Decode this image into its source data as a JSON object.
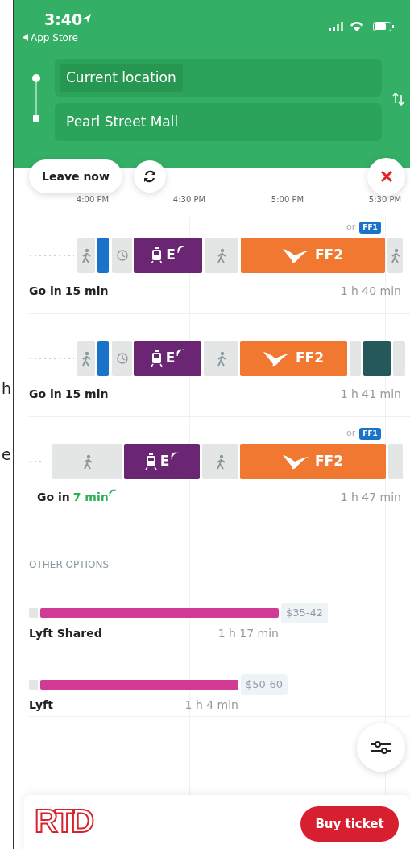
{
  "margin_text": [
    "h",
    "e"
  ],
  "status_bar": {
    "time": "3:40",
    "back_label": "App Store"
  },
  "route": {
    "origin": "Current location",
    "destination": "Pearl Street Mall"
  },
  "controls": {
    "leave_label": "Leave now"
  },
  "timeline": {
    "ticks": [
      "4:00 PM",
      "4:30 PM",
      "5:00 PM",
      "5:30 PM"
    ]
  },
  "trips": [
    {
      "alternative": {
        "prefix": "or",
        "route": "FF1"
      },
      "segments": [
        {
          "kind": "dots"
        },
        {
          "kind": "walk"
        },
        {
          "kind": "alert"
        },
        {
          "kind": "wait"
        },
        {
          "kind": "rail",
          "label": "E",
          "realtime": true
        },
        {
          "kind": "walk"
        },
        {
          "kind": "bus",
          "label": "FF2"
        },
        {
          "kind": "walk"
        }
      ],
      "depart_prefix": "Go in",
      "depart_time": "15 min",
      "realtime": false,
      "duration": "1 h 40 min"
    },
    {
      "segments": [
        {
          "kind": "dots"
        },
        {
          "kind": "walk"
        },
        {
          "kind": "alert"
        },
        {
          "kind": "wait"
        },
        {
          "kind": "rail",
          "label": "E",
          "realtime": true
        },
        {
          "kind": "walk"
        },
        {
          "kind": "bus",
          "label": "FF2"
        },
        {
          "kind": "gap"
        },
        {
          "kind": "block"
        },
        {
          "kind": "gap"
        }
      ],
      "depart_prefix": "Go in",
      "depart_time": "15 min",
      "realtime": false,
      "duration": "1 h 41 min"
    },
    {
      "alternative": {
        "prefix": "or",
        "route": "FF1"
      },
      "segments": [
        {
          "kind": "dots"
        },
        {
          "kind": "walk"
        },
        {
          "kind": "rail",
          "label": "E",
          "realtime": true
        },
        {
          "kind": "walk"
        },
        {
          "kind": "bus",
          "label": "FF2"
        },
        {
          "kind": "gap"
        }
      ],
      "depart_prefix": "Go in",
      "depart_time": "7 min",
      "realtime": true,
      "duration": "1 h 47 min"
    }
  ],
  "other_options": {
    "heading": "OTHER OPTIONS",
    "items": [
      {
        "name": "Lyft Shared",
        "duration": "1 h 17 min",
        "price": "$35-42"
      },
      {
        "name": "Lyft",
        "duration": "1 h 4 min",
        "price": "$50-60"
      }
    ]
  },
  "footer": {
    "logo": "RTD",
    "button": "Buy ticket"
  }
}
